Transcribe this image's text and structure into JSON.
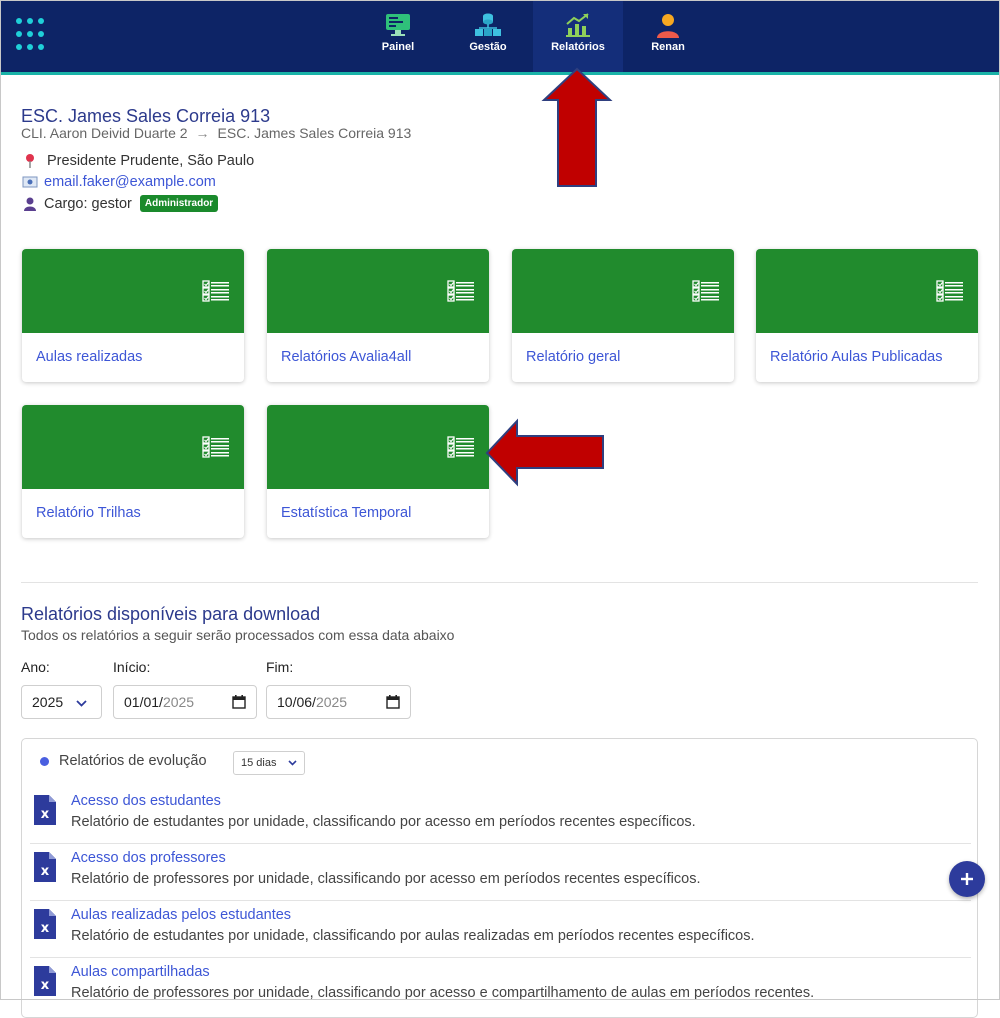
{
  "nav": {
    "items": [
      {
        "label": "Painel"
      },
      {
        "label": "Gestão"
      },
      {
        "label": "Relatórios"
      },
      {
        "label": "Renan"
      }
    ],
    "active": "Relatórios"
  },
  "header": {
    "school": "ESC. James Sales Correia 913",
    "breadcrumb": [
      "CLI. Aaron Deivid Duarte 2",
      "ESC. James Sales Correia 913"
    ],
    "breadcrumb_separator": "→",
    "location": "Presidente Prudente, São Paulo",
    "email": "email.faker@example.com",
    "role_prefix": "Cargo: gestor",
    "role_badge": "Administrador"
  },
  "cards": [
    {
      "label": "Aulas realizadas"
    },
    {
      "label": "Relatórios Avalia4all"
    },
    {
      "label": "Relatório geral"
    },
    {
      "label": "Relatório Aulas Publicadas"
    },
    {
      "label": "Relatório Trilhas"
    },
    {
      "label": "Estatística Temporal"
    }
  ],
  "downloads": {
    "title": "Relatórios disponíveis para download",
    "subtitle": "Todos os relatórios a seguir serão processados com essa data abaixo",
    "year_label": "Ano:",
    "year_value": "2025",
    "start_label": "Início:",
    "start_day_month": "01/01/",
    "start_year": "2025",
    "end_label": "Fim:",
    "end_day_month": "10/06/",
    "end_year": "2025"
  },
  "evolution": {
    "label": "Relatórios de evolução",
    "period": "15 dias",
    "reports": [
      {
        "title": "Acesso dos estudantes",
        "desc": "Relatório de estudantes por unidade, classificando por acesso em períodos recentes específicos."
      },
      {
        "title": "Acesso dos professores",
        "desc": "Relatório de professores por unidade, classificando por acesso em períodos recentes específicos."
      },
      {
        "title": "Aulas realizadas pelos estudantes",
        "desc": "Relatório de estudantes por unidade, classificando por aulas realizadas em períodos recentes específicos."
      },
      {
        "title": "Aulas compartilhadas",
        "desc": "Relatório de professores por unidade, classificando por acesso e compartilhamento de aulas em períodos recentes."
      }
    ]
  },
  "colors": {
    "navbar": "#0d2466",
    "accent_line": "#19b3a8",
    "card_green": "#218b2d",
    "link_blue": "#3d56d6",
    "annotation_arrow": "#c00000"
  },
  "icons": {
    "apps": "apps-grid-icon",
    "painel": "monitor-icon",
    "gestao": "hierarchy-icon",
    "relatorios": "chart-growth-icon",
    "user": "user-avatar-icon",
    "card": "checklist-icon",
    "report": "excel-file-icon",
    "fab": "plus-icon"
  }
}
